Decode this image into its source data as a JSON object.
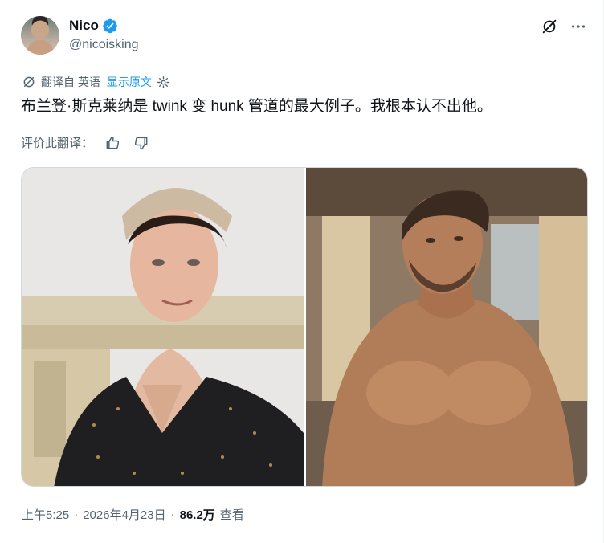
{
  "author": {
    "display_name": "Nico",
    "handle": "@nicoisking",
    "verified_color": "#1d9bf0"
  },
  "header_icons": [
    "grok-slash-icon",
    "more-icon"
  ],
  "translation": {
    "label": "翻译自 英语",
    "show_original": "显示原文"
  },
  "tweet": {
    "text": "布兰登·斯克莱纳是 twink 变 hunk 管道的最大例子。我根本认不出他。"
  },
  "rate_translation": {
    "label": "评价此翻译："
  },
  "media": {
    "images": [
      "young-man-in-cap-photo",
      "shirtless-man-photo"
    ]
  },
  "meta": {
    "time": "上午5:25",
    "sep1": "·",
    "date": "2026年4月23日",
    "sep2": "·",
    "views": "86.2万",
    "views_label": "查看"
  },
  "colors": {
    "accent": "#1d9bf0",
    "secondary_text": "#536471",
    "primary_text": "#0f1419"
  }
}
